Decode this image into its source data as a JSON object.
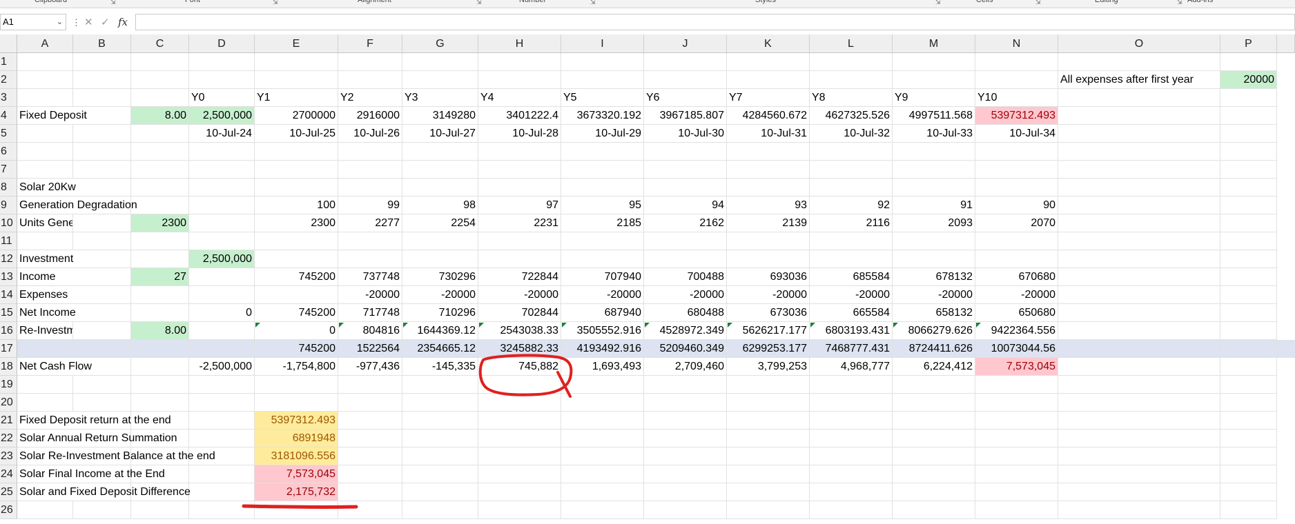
{
  "ribbon": {
    "groups": [
      "Clipboard",
      "Font",
      "Alignment",
      "Number",
      "Styles",
      "Cells",
      "Editing",
      "Add-ins"
    ]
  },
  "formula_bar": {
    "name_box": "A1",
    "cancel": "✕",
    "enter": "✓",
    "fx": "fx",
    "formula": ""
  },
  "columns": [
    "A",
    "B",
    "C",
    "D",
    "E",
    "F",
    "G",
    "H",
    "I",
    "J",
    "K",
    "L",
    "M",
    "N",
    "O",
    "P"
  ],
  "rows": [
    "1",
    "2",
    "3",
    "4",
    "5",
    "6",
    "7",
    "8",
    "9",
    "10",
    "11",
    "12",
    "13",
    "14",
    "15",
    "16",
    "17",
    "18",
    "19",
    "20",
    "21",
    "22",
    "23",
    "24",
    "25",
    "26"
  ],
  "colors": {
    "green_fill": "#c6efce",
    "red_fill": "#ffc7ce",
    "red_text": "#9c0006",
    "yellow_fill": "#ffeb9c",
    "yellow_text": "#9c5700",
    "band_fill": "#dde3f0",
    "annotation_red": "#e02020"
  },
  "cells": {
    "O2": "All expenses after first year",
    "P2": "20000",
    "D3": "Y0",
    "E3": "Y1",
    "F3": "Y2",
    "G3": "Y3",
    "H3": "Y4",
    "I3": "Y5",
    "J3": "Y6",
    "K3": "Y7",
    "L3": "Y8",
    "M3": "Y9",
    "N3": "Y10",
    "A4": "Fixed Deposit",
    "C4": "8.00",
    "D4": "2,500,000",
    "E4": "2700000",
    "F4": "2916000",
    "G4": "3149280",
    "H4": "3401222.4",
    "I4": "3673320.192",
    "J4": "3967185.807",
    "K4": "4284560.672",
    "L4": "4627325.526",
    "M4": "4997511.568",
    "N4": "5397312.493",
    "D5": "10-Jul-24",
    "E5": "10-Jul-25",
    "F5": "10-Jul-26",
    "G5": "10-Jul-27",
    "H5": "10-Jul-28",
    "I5": "10-Jul-29",
    "J5": "10-Jul-30",
    "K5": "10-Jul-31",
    "L5": "10-Jul-32",
    "M5": "10-Jul-33",
    "N5": "10-Jul-34",
    "A8": "Solar 20Kw",
    "A9": "Generation Degradation",
    "E9": "100",
    "F9": "99",
    "G9": "98",
    "H9": "97",
    "I9": "95",
    "J9": "94",
    "K9": "93",
    "L9": "92",
    "M9": "91",
    "N9": "90",
    "A10": "Units Generated Per I",
    "C10": "2300",
    "E10": "2300",
    "F10": "2277",
    "G10": "2254",
    "H10": "2231",
    "I10": "2185",
    "J10": "2162",
    "K10": "2139",
    "L10": "2116",
    "M10": "2093",
    "N10": "2070",
    "A12": "Investment",
    "D12": "2,500,000",
    "A13": "Income",
    "C13": "27",
    "E13": "745200",
    "F13": "737748",
    "G13": "730296",
    "H13": "722844",
    "I13": "707940",
    "J13": "700488",
    "K13": "693036",
    "L13": "685584",
    "M13": "678132",
    "N13": "670680",
    "A14": "Expenses",
    "F14": "-20000",
    "G14": "-20000",
    "H14": "-20000",
    "I14": "-20000",
    "J14": "-20000",
    "K14": "-20000",
    "L14": "-20000",
    "M14": "-20000",
    "N14": "-20000",
    "A15": "Net Income",
    "D15": "0",
    "E15": "745200",
    "F15": "717748",
    "G15": "710296",
    "H15": "702844",
    "I15": "687940",
    "J15": "680488",
    "K15": "673036",
    "L15": "665584",
    "M15": "658132",
    "N15": "650680",
    "A16": "Re-Investment Profit",
    "C16": "8.00",
    "E16": "0",
    "F16": "804816",
    "G16": "1644369.12",
    "H16": "2543038.33",
    "I16": "3505552.916",
    "J16": "4528972.349",
    "K16": "5626217.177",
    "L16": "6803193.431",
    "M16": "8066279.626",
    "N16": "9422364.556",
    "E17": "745200",
    "F17": "1522564",
    "G17": "2354665.12",
    "H17": "3245882.33",
    "I17": "4193492.916",
    "J17": "5209460.349",
    "K17": "6299253.177",
    "L17": "7468777.431",
    "M17": "8724411.626",
    "N17": "10073044.56",
    "A18": "Net Cash Flow",
    "D18": "-2,500,000",
    "E18": "-1,754,800",
    "F18": "-977,436",
    "G18": "-145,335",
    "H18": "745,882",
    "I18": "1,693,493",
    "J18": "2,709,460",
    "K18": "3,799,253",
    "L18": "4,968,777",
    "M18": "6,224,412",
    "N18": "7,573,045",
    "A21": "Fixed Deposit return at the end",
    "E21": "5397312.493",
    "A22": "Solar Annual Return Summation",
    "E22": "6891948",
    "A23": "Solar Re-Investment Balance at the end",
    "E23": "3181096.556",
    "A24": "Solar Final Income at the End",
    "E24": "7,573,045",
    "A25": "Solar and Fixed Deposit Difference",
    "E25": "2,175,732"
  }
}
